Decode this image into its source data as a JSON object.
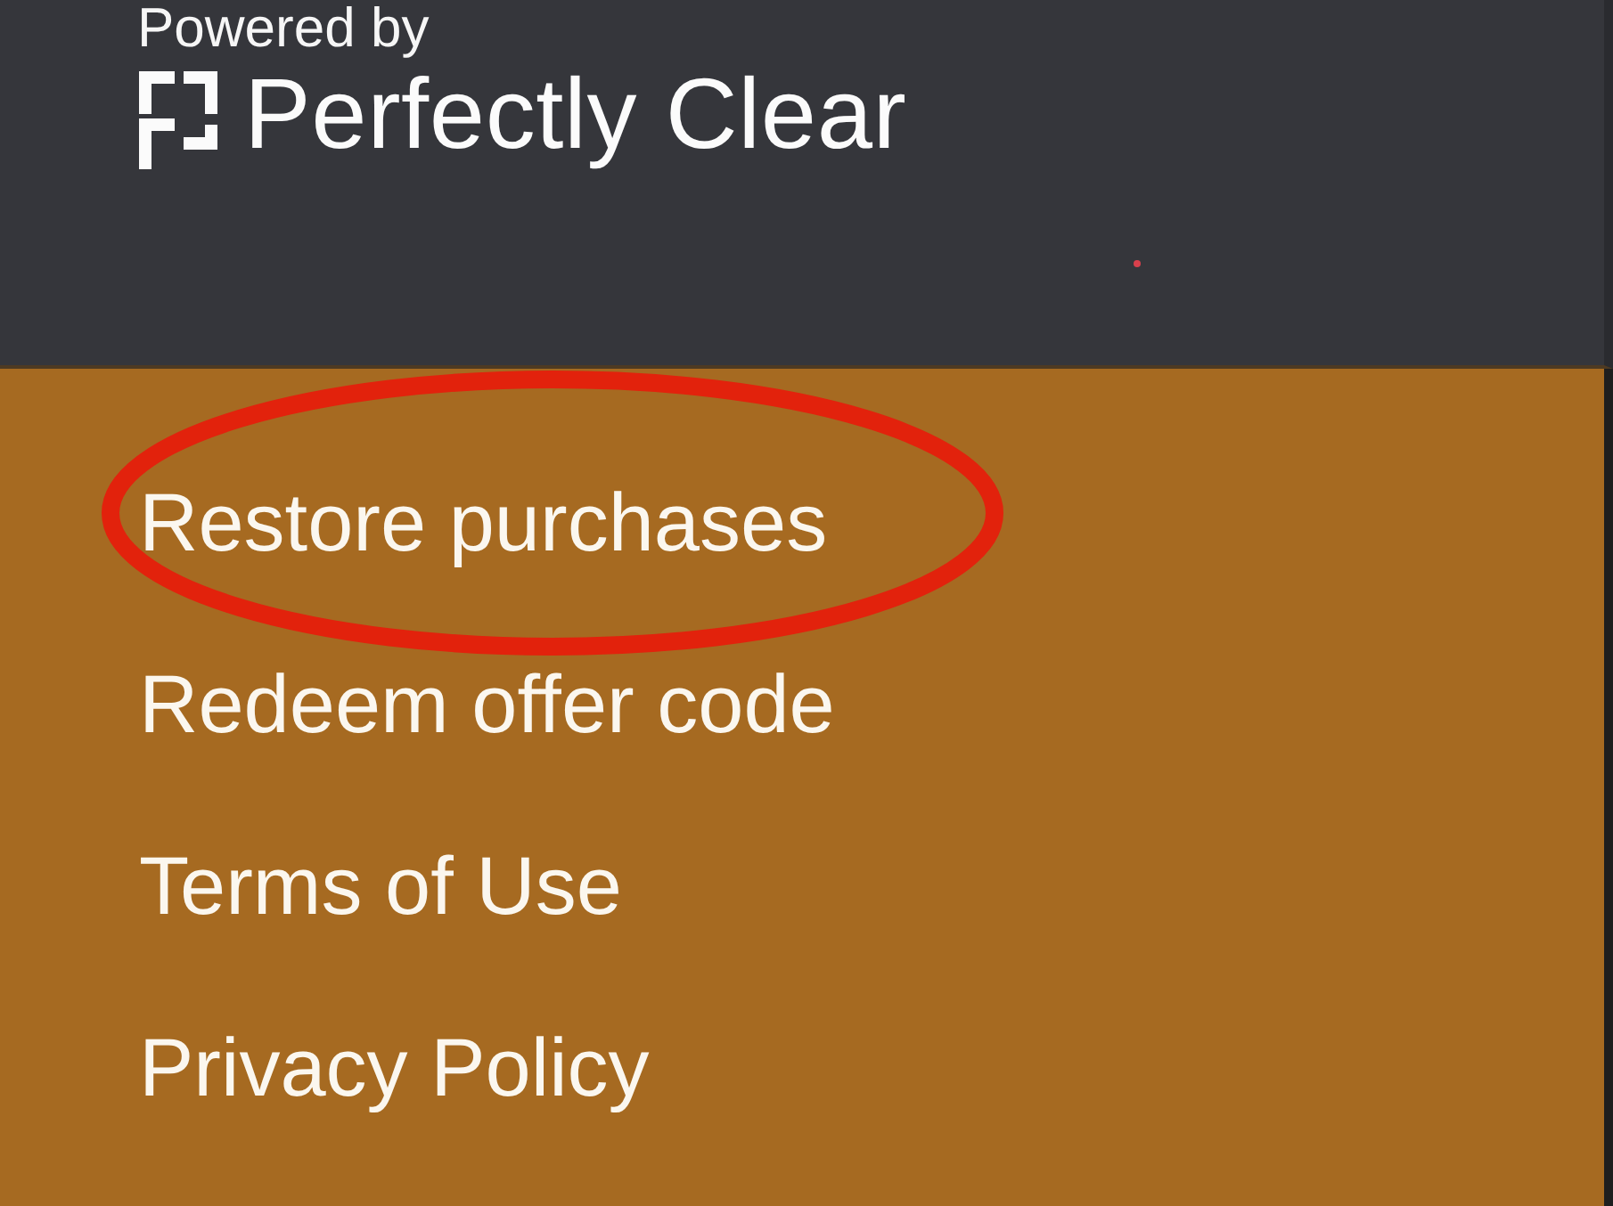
{
  "header": {
    "tagline": "Powered by",
    "brand": "Perfectly Clear"
  },
  "menu": [
    {
      "label": "Restore purchases",
      "circled": true
    },
    {
      "label": "Redeem offer code",
      "circled": false
    },
    {
      "label": "Terms of Use",
      "circled": false
    },
    {
      "label": "Privacy Policy",
      "circled": false
    }
  ]
}
